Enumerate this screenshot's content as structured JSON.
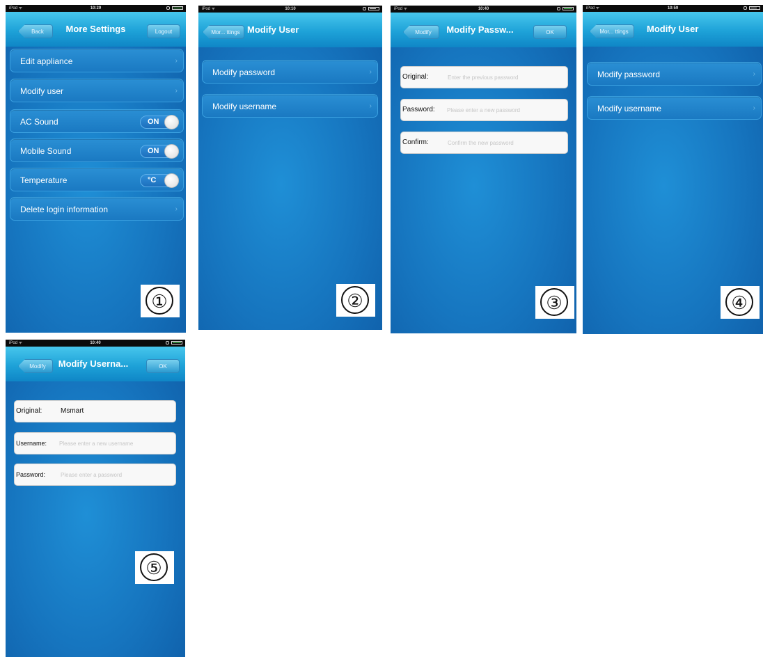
{
  "screens": [
    {
      "status": {
        "carrier": "iPod ᯤ",
        "time": "10:29"
      },
      "nav": {
        "back": "Back",
        "title": "More Settings",
        "right": "Logout"
      },
      "rows": [
        {
          "label": "Edit appliance"
        },
        {
          "label": "Modify user"
        },
        {
          "label": "AC Sound",
          "toggle": "ON"
        },
        {
          "label": "Mobile Sound",
          "toggle": "ON"
        },
        {
          "label": "Temperature",
          "toggle": "°C"
        },
        {
          "label": "Delete login information"
        }
      ],
      "badge": "①"
    },
    {
      "status": {
        "carrier": "iPod ᯤ",
        "time": "10:10"
      },
      "nav": {
        "back": "Mor... ttings",
        "title": "Modify User"
      },
      "rows": [
        {
          "label": "Modify password"
        },
        {
          "label": "Modify username"
        }
      ],
      "badge": "②"
    },
    {
      "status": {
        "carrier": "iPod ᯤ",
        "time": "10:40"
      },
      "nav": {
        "back": "Modify",
        "title": "Modify Passw...",
        "right": "OK"
      },
      "fields": [
        {
          "label": "Original:",
          "placeholder": "Enter the previous password"
        },
        {
          "label": "Password:",
          "placeholder": "Please enter a new password"
        },
        {
          "label": "Confirm:",
          "placeholder": "Confirm the new password"
        }
      ],
      "badge": "③"
    },
    {
      "status": {
        "carrier": "iPod ᯤ",
        "time": "10:59"
      },
      "nav": {
        "back": "Mor... ttings",
        "title": "Modify User"
      },
      "rows": [
        {
          "label": "Modify password"
        },
        {
          "label": "Modify username"
        }
      ],
      "badge": "④"
    },
    {
      "status": {
        "carrier": "iPod ᯤ",
        "time": "10:40"
      },
      "nav": {
        "back": "Modify",
        "title": "Modify Userna...",
        "right": "OK"
      },
      "fields": [
        {
          "label": "Original:",
          "value": "Msmart"
        },
        {
          "label": "Username:",
          "placeholder": "Please enter a new username"
        },
        {
          "label": "Password:",
          "placeholder": "Please enter a password"
        }
      ],
      "badge": "⑤"
    }
  ],
  "colors": {
    "accent": "#1ea2d8",
    "background": "#1675bf",
    "toggle_knob": "#ffffff"
  }
}
